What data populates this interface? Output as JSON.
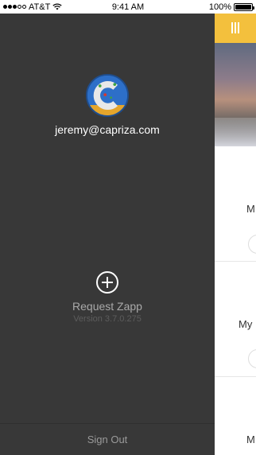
{
  "status_bar": {
    "carrier": "AT&T",
    "time": "9:41 AM",
    "battery_percent": "100%",
    "battery_level": 1.0,
    "signal_dots_filled": 3,
    "signal_dots_total": 5
  },
  "drawer": {
    "user_email": "jeremy@capriza.com",
    "avatar_letter": "C",
    "request_label": "Request Zapp",
    "version_label": "Version 3.7.0.275",
    "sign_out_label": "Sign Out"
  },
  "main": {
    "menu_icon": "menu-icon",
    "accent_color": "#f3c03d",
    "cards": [
      {
        "label": "M"
      },
      {
        "label": "My"
      },
      {
        "label": "M"
      }
    ]
  }
}
